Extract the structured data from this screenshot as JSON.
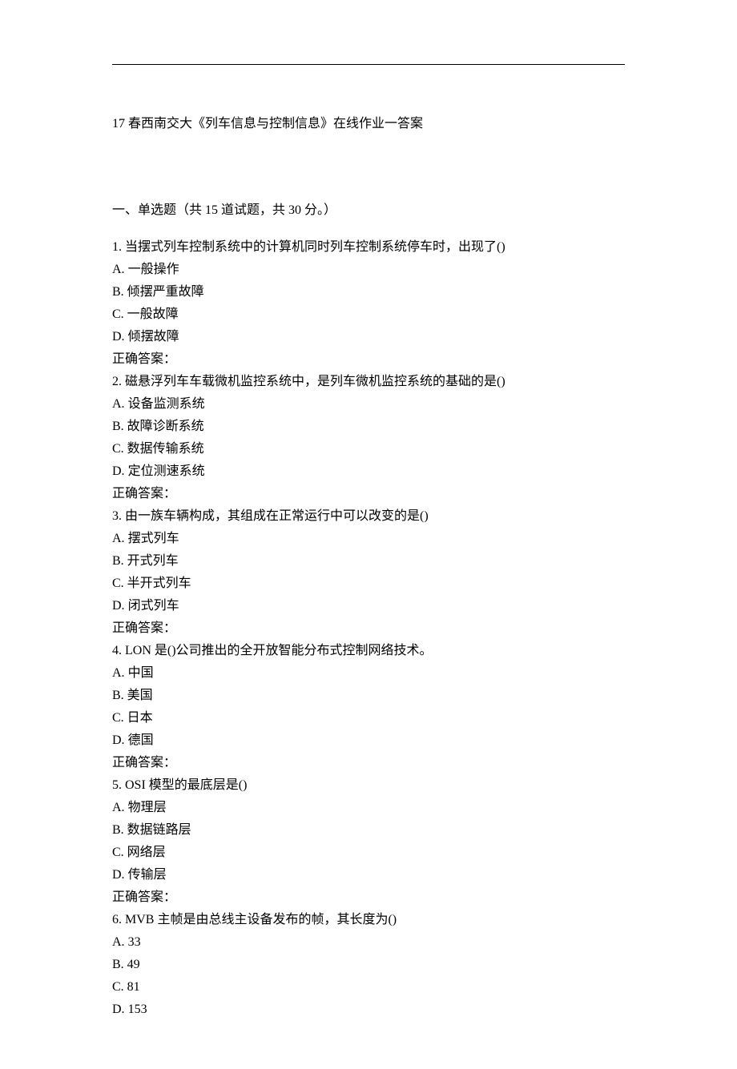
{
  "title": "17 春西南交大《列车信息与控制信息》在线作业一答案",
  "section_header": "一、单选题（共 15 道试题，共 30 分。）",
  "answer_label": "正确答案：",
  "questions": [
    {
      "num": "1.",
      "text": "当摆式列车控制系统中的计算机同时列车控制系统停车时，出现了()",
      "options": [
        {
          "label": "A.",
          "text": "一般操作"
        },
        {
          "label": "B.",
          "text": "倾摆严重故障"
        },
        {
          "label": "C.",
          "text": "一般故障"
        },
        {
          "label": "D.",
          "text": "倾摆故障"
        }
      ]
    },
    {
      "num": "2.",
      "text": "磁悬浮列车车载微机监控系统中，是列车微机监控系统的基础的是()",
      "options": [
        {
          "label": "A.",
          "text": "设备监测系统"
        },
        {
          "label": "B.",
          "text": "故障诊断系统"
        },
        {
          "label": "C.",
          "text": "数据传输系统"
        },
        {
          "label": "D.",
          "text": "定位测速系统"
        }
      ]
    },
    {
      "num": "3.",
      "text": "由一族车辆构成，其组成在正常运行中可以改变的是()",
      "options": [
        {
          "label": "A.",
          "text": "摆式列车"
        },
        {
          "label": "B.",
          "text": "开式列车"
        },
        {
          "label": "C.",
          "text": "半开式列车"
        },
        {
          "label": "D.",
          "text": "闭式列车"
        }
      ]
    },
    {
      "num": "4.",
      "text": "LON 是()公司推出的全开放智能分布式控制网络技术。",
      "options": [
        {
          "label": "A.",
          "text": "中国"
        },
        {
          "label": "B.",
          "text": "美国"
        },
        {
          "label": "C.",
          "text": "日本"
        },
        {
          "label": "D.",
          "text": "德国"
        }
      ]
    },
    {
      "num": "5.",
      "text": "OSI 模型的最底层是()",
      "options": [
        {
          "label": "A.",
          "text": "物理层"
        },
        {
          "label": "B.",
          "text": "数据链路层"
        },
        {
          "label": "C.",
          "text": "网络层"
        },
        {
          "label": "D.",
          "text": "传输层"
        }
      ]
    },
    {
      "num": "6.",
      "text": "MVB 主帧是由总线主设备发布的帧，其长度为()",
      "options": [
        {
          "label": "A.",
          "text": "33"
        },
        {
          "label": "B.",
          "text": "49"
        },
        {
          "label": "C.",
          "text": "81"
        },
        {
          "label": "D.",
          "text": "153"
        }
      ]
    }
  ]
}
